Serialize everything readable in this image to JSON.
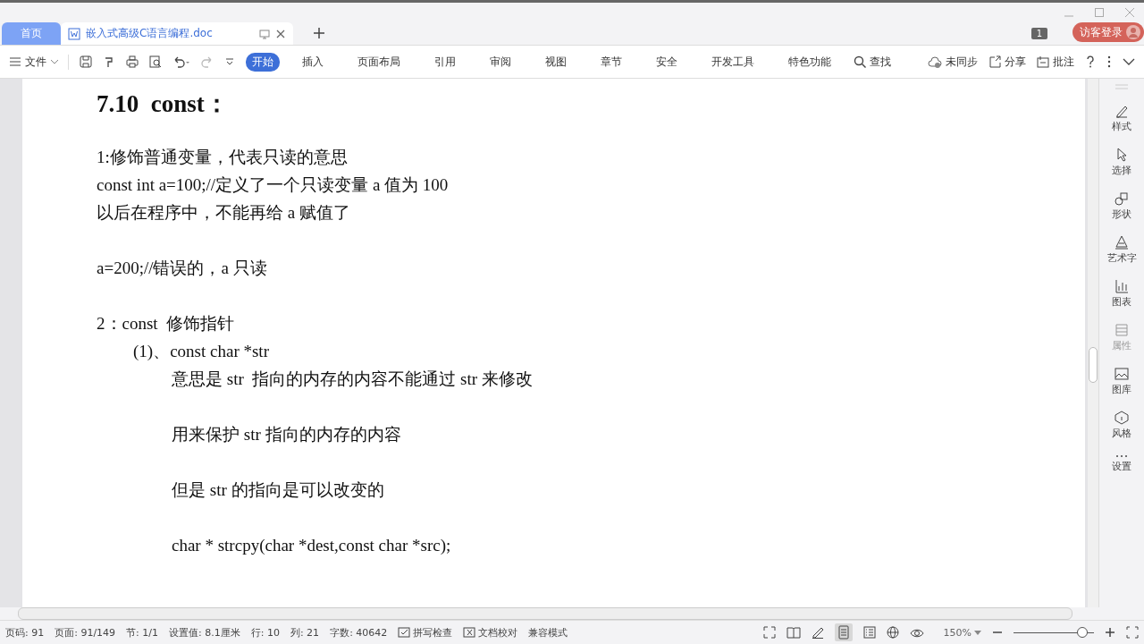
{
  "tabs": [
    {
      "label": "首页",
      "kind": "home",
      "selected": false
    },
    {
      "label": "嵌入式高级C语言编程.doc",
      "kind": "doc",
      "selected": true
    }
  ],
  "account": {
    "badge": "1",
    "login": "访客登录"
  },
  "menu": {
    "file": "文件",
    "ribbon_tabs": [
      {
        "label": "开始",
        "selected": true
      },
      {
        "label": "插入",
        "selected": false
      },
      {
        "label": "页面布局",
        "selected": false
      },
      {
        "label": "引用",
        "selected": false
      },
      {
        "label": "审阅",
        "selected": false
      },
      {
        "label": "视图",
        "selected": false
      },
      {
        "label": "章节",
        "selected": false
      },
      {
        "label": "安全",
        "selected": false
      },
      {
        "label": "开发工具",
        "selected": false
      },
      {
        "label": "特色功能",
        "selected": false
      }
    ],
    "search": "查找",
    "sync": "未同步",
    "share": "分享",
    "comment": "批注"
  },
  "document": {
    "heading": "7.10  const：",
    "blocks": [
      [
        {
          "text": "1:修饰普通变量，代表只读的意思"
        },
        {
          "text": "const int a=100;//定义了一个只读变量 a 值为 100"
        },
        {
          "text": "以后在程序中，不能再给 a 赋值了"
        }
      ],
      [
        {
          "text": "a=200;//错误的，a 只读"
        }
      ],
      [
        {
          "text": "2：const  修饰指针",
          "children": [
            {
              "text": "(1)、const char *str",
              "children": [
                {
                  "text": "意思是 str  指向的内存的内容不能通过 str 来修改"
                }
              ]
            }
          ]
        }
      ],
      [
        {
          "text": "用来保护 str 指向的内存的内容",
          "indent_under": true
        }
      ],
      [
        {
          "text": "但是 str 的指向是可以改变的",
          "indent_under": true
        }
      ],
      [
        {
          "text": "char * strcpy(char *dest,const char *src);",
          "indent_under": true
        }
      ]
    ]
  },
  "side_panel": [
    {
      "label": "样式",
      "kind": "pen",
      "disabled": false
    },
    {
      "label": "选择",
      "kind": "cursor",
      "disabled": false
    },
    {
      "label": "形状",
      "kind": "shape",
      "disabled": false
    },
    {
      "label": "艺术字",
      "kind": "art",
      "disabled": false
    },
    {
      "label": "图表",
      "kind": "chart",
      "disabled": false
    },
    {
      "label": "属性",
      "kind": "props",
      "disabled": true
    },
    {
      "label": "图库",
      "kind": "image",
      "disabled": false
    },
    {
      "label": "风格",
      "kind": "style",
      "disabled": false
    },
    {
      "label": "设置",
      "kind": "more",
      "disabled": false
    }
  ],
  "status_bar": {
    "items": [
      "页码: 91",
      "页面: 91/149",
      "节: 1/1",
      "设置值: 8.1厘米",
      "行: 10",
      "列: 21",
      "字数: 40642"
    ],
    "spell": "拼写检查",
    "proof": "文档校对",
    "mode": "兼容模式",
    "zoom": "150%",
    "zoom_slider": {
      "level": 0.85
    }
  }
}
